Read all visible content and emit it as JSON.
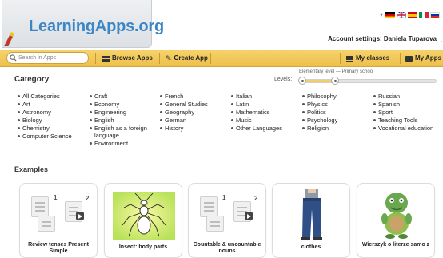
{
  "header": {
    "logo_text": "LearningApps.org",
    "account_label": "Account settings: Daniela Tuparova",
    "cursor_glyph": ","
  },
  "toolbar": {
    "search_placeholder": "Search in Apps",
    "browse_apps": "Browse Apps",
    "create_app": "Create App",
    "my_classes": "My classes",
    "my_apps": "My Apps"
  },
  "category": {
    "title": "Category",
    "levels_label": "Levels:",
    "level_caption": "Elementary level — Primary school",
    "level_range": [
      0,
      0.25
    ],
    "columns": [
      [
        "All Categories",
        "Art",
        "Astronomy",
        "Biology",
        "Chemistry",
        "Computer Science"
      ],
      [
        "Craft",
        "Economy",
        "Engineering",
        "English",
        "English as a foreign language",
        "Environment"
      ],
      [
        "French",
        "General Studies",
        "Geography",
        "German",
        "History"
      ],
      [
        "Italian",
        "Latin",
        "Mathematics",
        "Music",
        "Other Languages"
      ],
      [
        "Philosophy",
        "Physics",
        "Politics",
        "Psychology",
        "Religion"
      ],
      [
        "Russian",
        "Spanish",
        "Sport",
        "Teaching Tools",
        "Vocational education"
      ]
    ]
  },
  "examples": {
    "title": "Examples",
    "cards": [
      {
        "caption": "Review tenses Present Simple",
        "thumb": "placeholder"
      },
      {
        "caption": "Insect: body parts",
        "thumb": "insect"
      },
      {
        "caption": "Countable & uncountable nouns",
        "thumb": "placeholder"
      },
      {
        "caption": "clothes",
        "thumb": "jeans"
      },
      {
        "caption": "Wierszyk o literze samo z",
        "thumb": "turtle"
      }
    ],
    "placeholder_nums": [
      "1",
      "2"
    ]
  },
  "colors": {
    "toolbar": "#edc04c",
    "logo_blue": "#3d86c6",
    "slider_fill": "#f2cf6a"
  },
  "icons": [
    "search-icon",
    "grid-icon",
    "pencil-icon",
    "list-icon",
    "folder-icon",
    "flag-icon"
  ]
}
